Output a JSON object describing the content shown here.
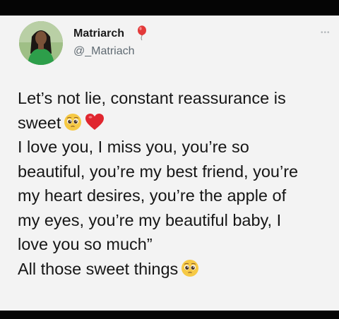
{
  "user": {
    "name": "Matriarch",
    "handle": "@_Matriach"
  },
  "menu_icon": "more-horizontal-icon",
  "tweet": {
    "line1": "Let’s not lie, constant reassurance is",
    "line2": "sweet",
    "line3": "I love you, I miss you, you’re so",
    "line4": "beautiful, you’re my best friend, you’re",
    "line5": "my heart desires, you’re the apple of",
    "line6": "my eyes, you’re my beautiful baby, I",
    "line7": "love you so much”",
    "line8": "All those sweet things"
  },
  "colors": {
    "background": "#f3f3f3",
    "text": "#161616",
    "handle": "#5f6a72",
    "heart": "#e0262f",
    "balloon": "#e33a3a"
  }
}
